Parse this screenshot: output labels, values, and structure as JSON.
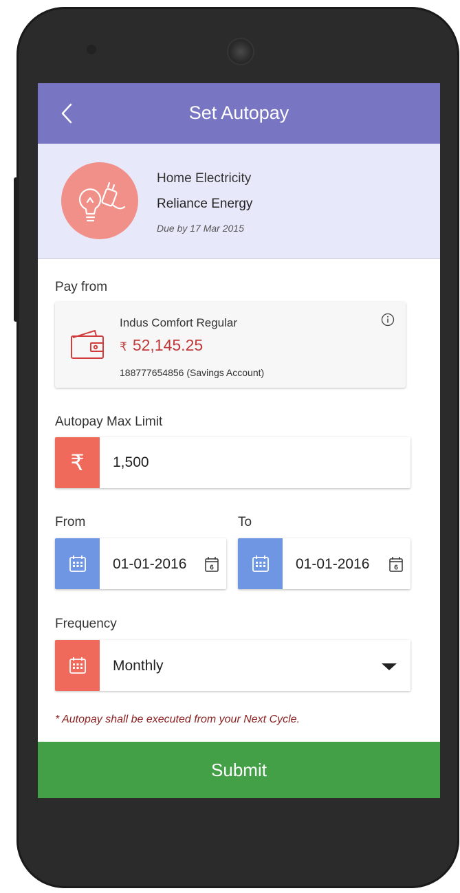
{
  "appbar": {
    "title": "Set Autopay",
    "back_icon": "chevron-left-icon"
  },
  "biller": {
    "category": "Home Electricity",
    "name": "Reliance Energy",
    "due": "Due by 17 Mar 2015",
    "icon": "bulb-and-plug-icon",
    "icon_color": "#f09088"
  },
  "pay_from": {
    "label": "Pay from",
    "account_name": "Indus Comfort Regular",
    "currency_symbol": "₹",
    "balance": "52,145.25",
    "account_number": "188777654856 (Savings Account)",
    "icon": "wallet-icon",
    "info_icon": "info-icon"
  },
  "max_limit": {
    "label": "Autopay Max Limit",
    "currency_symbol": "₹",
    "value": "1,500"
  },
  "from": {
    "label": "From",
    "value": "01-01-2016",
    "picker_day": "6"
  },
  "to": {
    "label": "To",
    "value": "01-01-2016",
    "picker_day": "6"
  },
  "frequency": {
    "label": "Frequency",
    "value": "Monthly"
  },
  "note": "* Autopay shall be executed from your Next Cycle.",
  "submit_label": "Submit",
  "colors": {
    "appbar": "#7875c2",
    "biller_bg": "#e8e8fb",
    "accent_red": "#f06a5b",
    "accent_blue": "#6f96e2",
    "submit": "#43a047",
    "balance_text": "#c0393b",
    "note_text": "#8a2020"
  }
}
